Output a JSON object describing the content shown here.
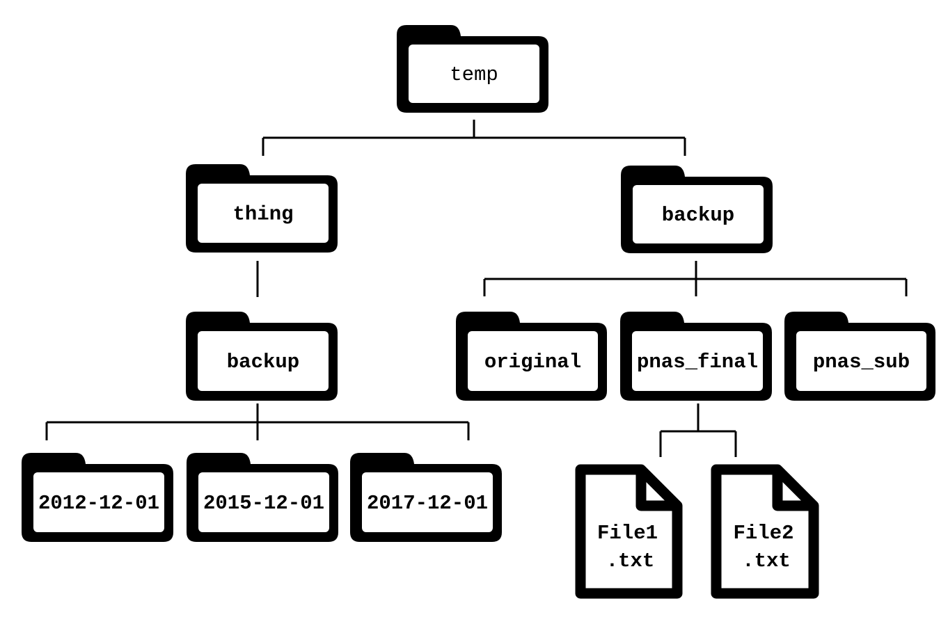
{
  "colors": {
    "stroke": "#000000",
    "fill": "#ffffff"
  },
  "nodes": {
    "temp": {
      "label": "temp",
      "type": "folder-icon"
    },
    "thing": {
      "label": "thing",
      "type": "folder-icon"
    },
    "backup_right": {
      "label": "backup",
      "type": "folder-icon"
    },
    "backup_left": {
      "label": "backup",
      "type": "folder-icon"
    },
    "original": {
      "label": "original",
      "type": "folder-icon"
    },
    "pnas_final": {
      "label": "pnas_final",
      "type": "folder-icon"
    },
    "pnas_sub": {
      "label": "pnas_sub",
      "type": "folder-icon"
    },
    "d2012": {
      "label": "2012-12-01",
      "type": "folder-icon"
    },
    "d2015": {
      "label": "2015-12-01",
      "type": "folder-icon"
    },
    "d2017": {
      "label": "2017-12-01",
      "type": "folder-icon"
    },
    "file1": {
      "label_line1": "File1",
      "label_line2": ".txt",
      "type": "file-icon"
    },
    "file2": {
      "label_line1": "File2",
      "label_line2": ".txt",
      "type": "file-icon"
    }
  },
  "edges": [
    [
      "temp",
      "thing"
    ],
    [
      "temp",
      "backup_right"
    ],
    [
      "thing",
      "backup_left"
    ],
    [
      "backup_left",
      "d2012"
    ],
    [
      "backup_left",
      "d2015"
    ],
    [
      "backup_left",
      "d2017"
    ],
    [
      "backup_right",
      "original"
    ],
    [
      "backup_right",
      "pnas_final"
    ],
    [
      "backup_right",
      "pnas_sub"
    ],
    [
      "pnas_final",
      "file1"
    ],
    [
      "pnas_final",
      "file2"
    ]
  ]
}
